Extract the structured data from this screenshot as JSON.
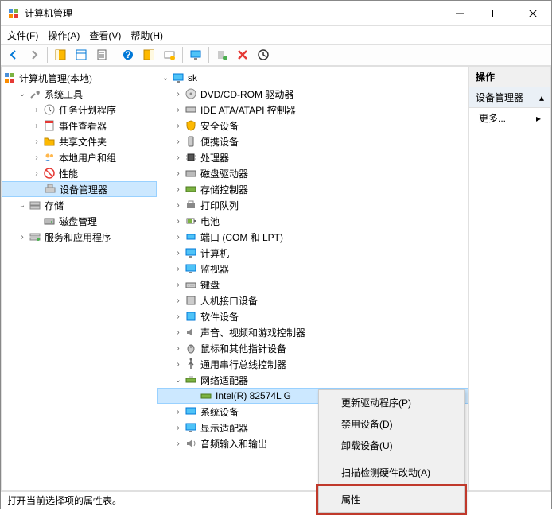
{
  "window": {
    "title": "计算机管理"
  },
  "menu": {
    "file": "文件(F)",
    "action": "操作(A)",
    "view": "查看(V)",
    "help": "帮助(H)"
  },
  "left_tree": {
    "root": "计算机管理(本地)",
    "system_tools": "系统工具",
    "task_scheduler": "任务计划程序",
    "event_viewer": "事件查看器",
    "shared_folders": "共享文件夹",
    "local_users": "本地用户和组",
    "performance": "性能",
    "device_manager": "设备管理器",
    "storage": "存储",
    "disk_management": "磁盘管理",
    "services": "服务和应用程序"
  },
  "mid_tree": {
    "root": "sk",
    "dvd": "DVD/CD-ROM 驱动器",
    "ide": "IDE ATA/ATAPI 控制器",
    "security": "安全设备",
    "portable": "便携设备",
    "processor": "处理器",
    "disk_drives": "磁盘驱动器",
    "storage_ctrl": "存储控制器",
    "print_queue": "打印队列",
    "battery": "电池",
    "ports": "端口 (COM 和 LPT)",
    "computer": "计算机",
    "monitor": "监视器",
    "keyboard": "键盘",
    "hid": "人机接口设备",
    "software": "软件设备",
    "sound": "声音、视频和游戏控制器",
    "mouse": "鼠标和其他指针设备",
    "usb_bus": "通用串行总线控制器",
    "network": "网络适配器",
    "intel_nic": "Intel(R) 82574L G",
    "system_dev": "系统设备",
    "display": "显示适配器",
    "audio_io": "音频输入和输出"
  },
  "actions": {
    "header": "操作",
    "sub": "设备管理器",
    "more": "更多..."
  },
  "context": {
    "update": "更新驱动程序(P)",
    "disable": "禁用设备(D)",
    "uninstall": "卸载设备(U)",
    "scan": "扫描检测硬件改动(A)",
    "properties": "属性"
  },
  "status": "打开当前选择项的属性表。"
}
